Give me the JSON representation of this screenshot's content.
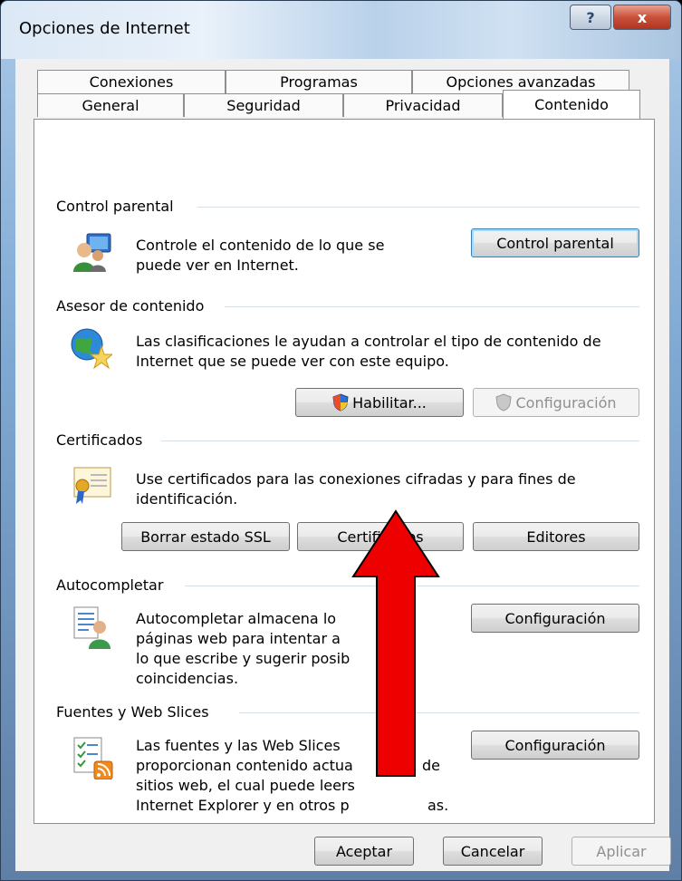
{
  "window": {
    "title": "Opciones de Internet",
    "help_label": "?",
    "close_label": "x"
  },
  "tabs": {
    "row1": [
      "Conexiones",
      "Programas",
      "Opciones avanzadas"
    ],
    "row2": [
      "General",
      "Seguridad",
      "Privacidad",
      "Contenido"
    ],
    "active": "Contenido"
  },
  "sections": {
    "parental": {
      "title": "Control parental",
      "desc": [
        "Controle el contenido de lo que se",
        "puede ver en Internet."
      ],
      "button": "Control parental"
    },
    "advisor": {
      "title": "Asesor de contenido",
      "desc": [
        "Las clasificaciones le ayudan a controlar el tipo de contenido de",
        "Internet que se puede ver con este equipo."
      ],
      "enable_button": "Habilitar...",
      "settings_button": "Configuración"
    },
    "certificates": {
      "title": "Certificados",
      "desc": [
        "Use certificados para las conexiones cifradas y para fines de",
        "identificación."
      ],
      "clear_ssl_button": "Borrar estado SSL",
      "certificates_button": "Certificados",
      "publishers_button": "Editores"
    },
    "autocomplete": {
      "title": "Autocompletar",
      "desc": [
        "Autocompletar almacena lo",
        "páginas web para intentar a",
        "lo que escribe y sugerir posib",
        "coincidencias."
      ],
      "button": "Configuración"
    },
    "feeds": {
      "title": "Fuentes y Web Slices",
      "desc": [
        "Las fuentes y las Web Slices",
        "proporcionan contenido actua",
        "sitios web, el cual puede leers",
        "Internet Explorer y en otros p"
      ],
      "desc_tail": [
        "de",
        "as."
      ],
      "button": "Configuración"
    }
  },
  "footer": {
    "ok": "Aceptar",
    "cancel": "Cancelar",
    "apply": "Aplicar"
  },
  "colors": {
    "arrow": "#ee0000",
    "accent": "#3c7fb1"
  }
}
